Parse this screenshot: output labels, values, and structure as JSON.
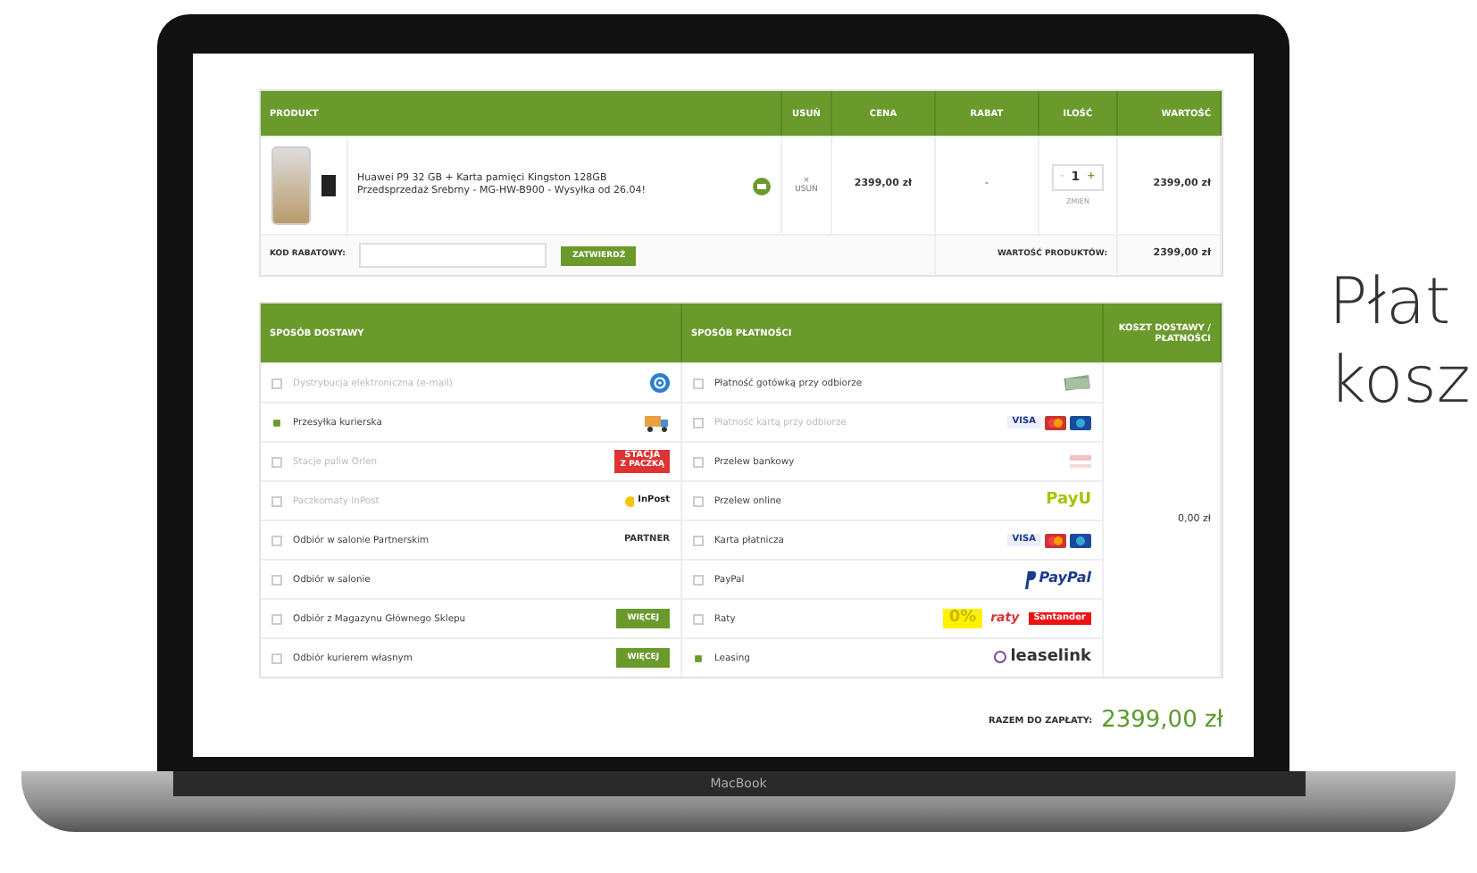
{
  "heading": {
    "lines": [
      "Płat",
      "kosz"
    ]
  },
  "cart": {
    "columns": [
      "PRODUKT",
      "USUŃ",
      "CENA",
      "RABAT",
      "ILOŚĆ",
      "WARTOŚĆ"
    ],
    "item": {
      "name": "Huawei P9 32 GB + Karta pamięci Kingston 128GB Przedsprzedaż Srebrny - MG-HW-B900 - Wysyłka od 26.04!",
      "remove_icon": "×",
      "remove_label": "USUŃ",
      "price": "2399,00 zł",
      "discount": "-",
      "qty_minus": "-",
      "qty": "1",
      "qty_plus": "+",
      "qty_change": "ZMIEŃ",
      "value": "2399,00 zł"
    },
    "coupon": {
      "label": "KOD RABATOWY:",
      "button": "ZATWIERDŹ",
      "total_label": "WARTOŚĆ PRODUKTÓW:",
      "total": "2399,00 zł"
    }
  },
  "delivery": {
    "title": "SPOSÓB DOSTAWY",
    "options": [
      {
        "label": "Dystrybucja elektroniczna (e-mail)",
        "selected": false,
        "disabled": true,
        "logo": {
          "kind": "email"
        }
      },
      {
        "label": "Przesyłka kurierska",
        "selected": true,
        "disabled": false,
        "logo": {
          "kind": "truck"
        }
      },
      {
        "label": "Stacje paliw Orlen",
        "selected": false,
        "disabled": true,
        "logo": {
          "kind": "stacja",
          "texts": [
            "STACJA",
            "Z PACZKĄ"
          ]
        }
      },
      {
        "label": "Paczkomaty InPost",
        "selected": false,
        "disabled": true,
        "logo": {
          "kind": "inpost",
          "texts": [
            "InPost"
          ]
        }
      },
      {
        "label": "Odbiór w salonie Partnerskim",
        "selected": false,
        "disabled": false,
        "logo": {
          "kind": "partner",
          "texts": [
            "PARTNER"
          ]
        }
      },
      {
        "label": "Odbiór w salonie",
        "selected": false,
        "disabled": false
      },
      {
        "label": "Odbiór z Magazynu Głównego Sklepu",
        "selected": false,
        "disabled": false,
        "logo": {
          "kind": "more",
          "texts": [
            "WIĘCEJ"
          ]
        }
      },
      {
        "label": "Odbiór kurierem własnym",
        "selected": false,
        "disabled": false,
        "logo": {
          "kind": "more",
          "texts": [
            "WIĘCEJ"
          ]
        }
      }
    ]
  },
  "payment": {
    "title": "SPOSÓB PŁATNOŚCI",
    "options": [
      {
        "label": "Płatność gotówką przy odbiorze",
        "selected": false,
        "disabled": false,
        "logo": {
          "kind": "cash"
        }
      },
      {
        "label": "Płatność kartą przy odbiorze",
        "selected": false,
        "disabled": true,
        "logo": {
          "kind": "cards",
          "texts": [
            "VISA"
          ]
        }
      },
      {
        "label": "Przelew bankowy",
        "selected": false,
        "disabled": false,
        "logo": {
          "kind": "bank"
        }
      },
      {
        "label": "Przelew online",
        "selected": false,
        "disabled": false,
        "logo": {
          "kind": "payu",
          "texts": [
            "PayU"
          ]
        }
      },
      {
        "label": "Karta płatnicza",
        "selected": false,
        "disabled": false,
        "logo": {
          "kind": "cards",
          "texts": [
            "VISA"
          ]
        }
      },
      {
        "label": "PayPal",
        "selected": false,
        "disabled": false,
        "logo": {
          "kind": "paypal",
          "texts": [
            "PayPal"
          ]
        }
      },
      {
        "label": "Raty",
        "selected": false,
        "disabled": false,
        "logo": {
          "kind": "raty",
          "texts": [
            "0%",
            "raty",
            "Santander"
          ]
        }
      },
      {
        "label": "Leasing",
        "selected": true,
        "disabled": false,
        "logo": {
          "kind": "leaselink",
          "texts": [
            "leaselink"
          ]
        }
      }
    ]
  },
  "cost": {
    "title": "KOSZT DOSTAWY / PŁATNOŚCI",
    "value": "0,00 zł"
  },
  "summary": {
    "label": "RAZEM DO ZAPŁATY:",
    "value": "2399,00 zł"
  },
  "laptop": {
    "label": "MacBook"
  }
}
